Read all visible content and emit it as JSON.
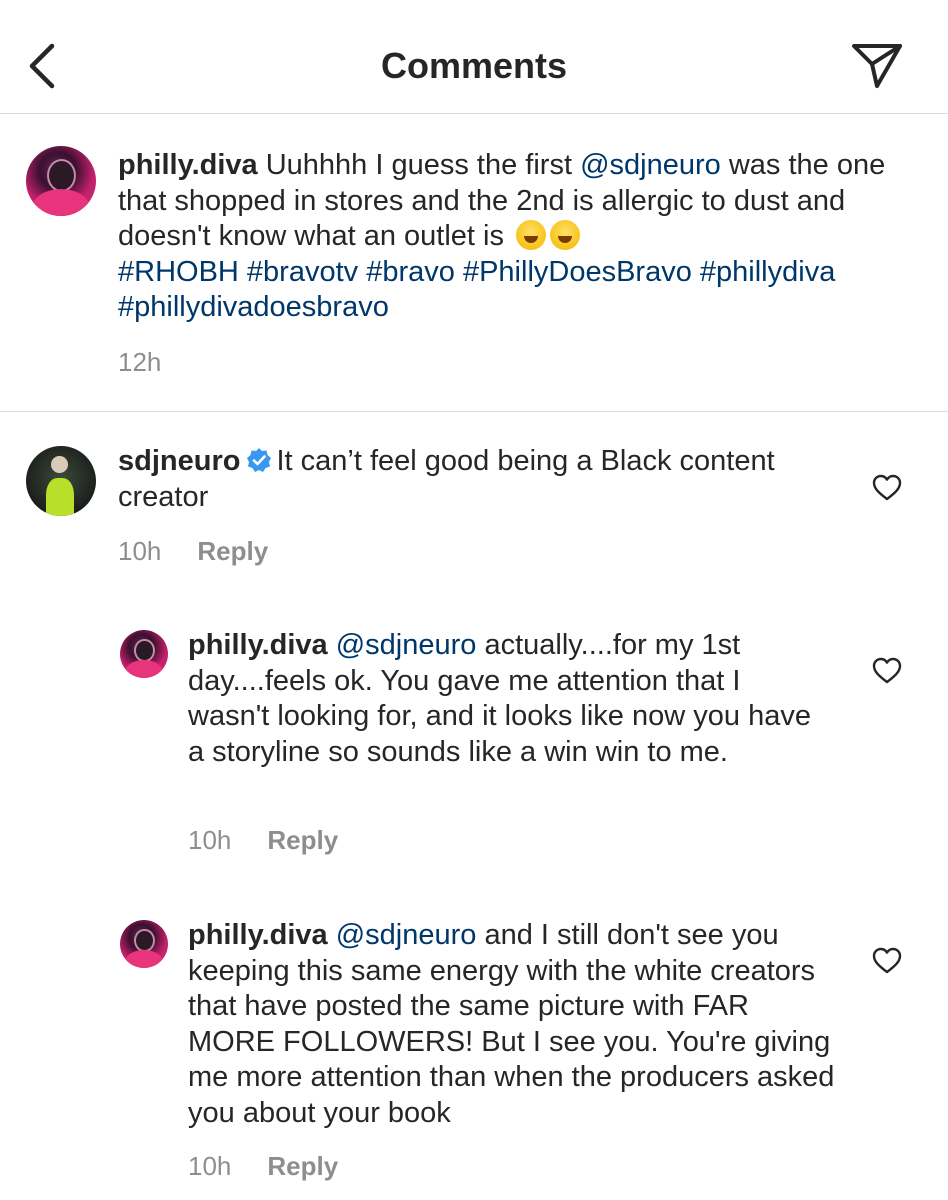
{
  "header": {
    "title": "Comments",
    "back_icon": "chevron-left-icon",
    "share_icon": "paper-plane-icon"
  },
  "caption": {
    "username": "philly.diva",
    "text_1": " Uuhhhh I guess the first ",
    "mention": "@sdjneuro",
    "text_2": " was the one that shopped in stores and the 2nd is allergic to dust and doesn't know what an outlet is ",
    "emoji": "grinning-squinting-face",
    "hashtags": [
      "#RHOBH",
      "#bravotv",
      "#bravo",
      "#PhillyDoesBravo",
      "#phillydiva",
      "#phillydivadoesbravo"
    ],
    "time": "12h"
  },
  "comments": [
    {
      "username": "sdjneuro",
      "verified": true,
      "text": "It can’t feel good being a Black content creator",
      "time": "10h",
      "reply_label": "Reply"
    },
    {
      "username": "philly.diva",
      "mention": "@sdjneuro",
      "text": " actually....for my 1st day....feels ok. You gave me attention that I wasn't looking for, and it looks like now you have a storyline so sounds like a win win to me.",
      "time": "10h",
      "reply_label": "Reply"
    },
    {
      "username": "philly.diva",
      "mention": "@sdjneuro",
      "text": " and I  still don't see you keeping this same energy with the white creators that have posted the same picture with FAR MORE FOLLOWERS! But I see you. You're giving me more attention than when the producers asked you about your book",
      "time": "10h",
      "reply_label": "Reply"
    }
  ],
  "colors": {
    "text": "#262626",
    "link": "#00376b",
    "meta": "#8e8e8e",
    "divider": "#dbdbdb",
    "verified": "#3897f0"
  }
}
